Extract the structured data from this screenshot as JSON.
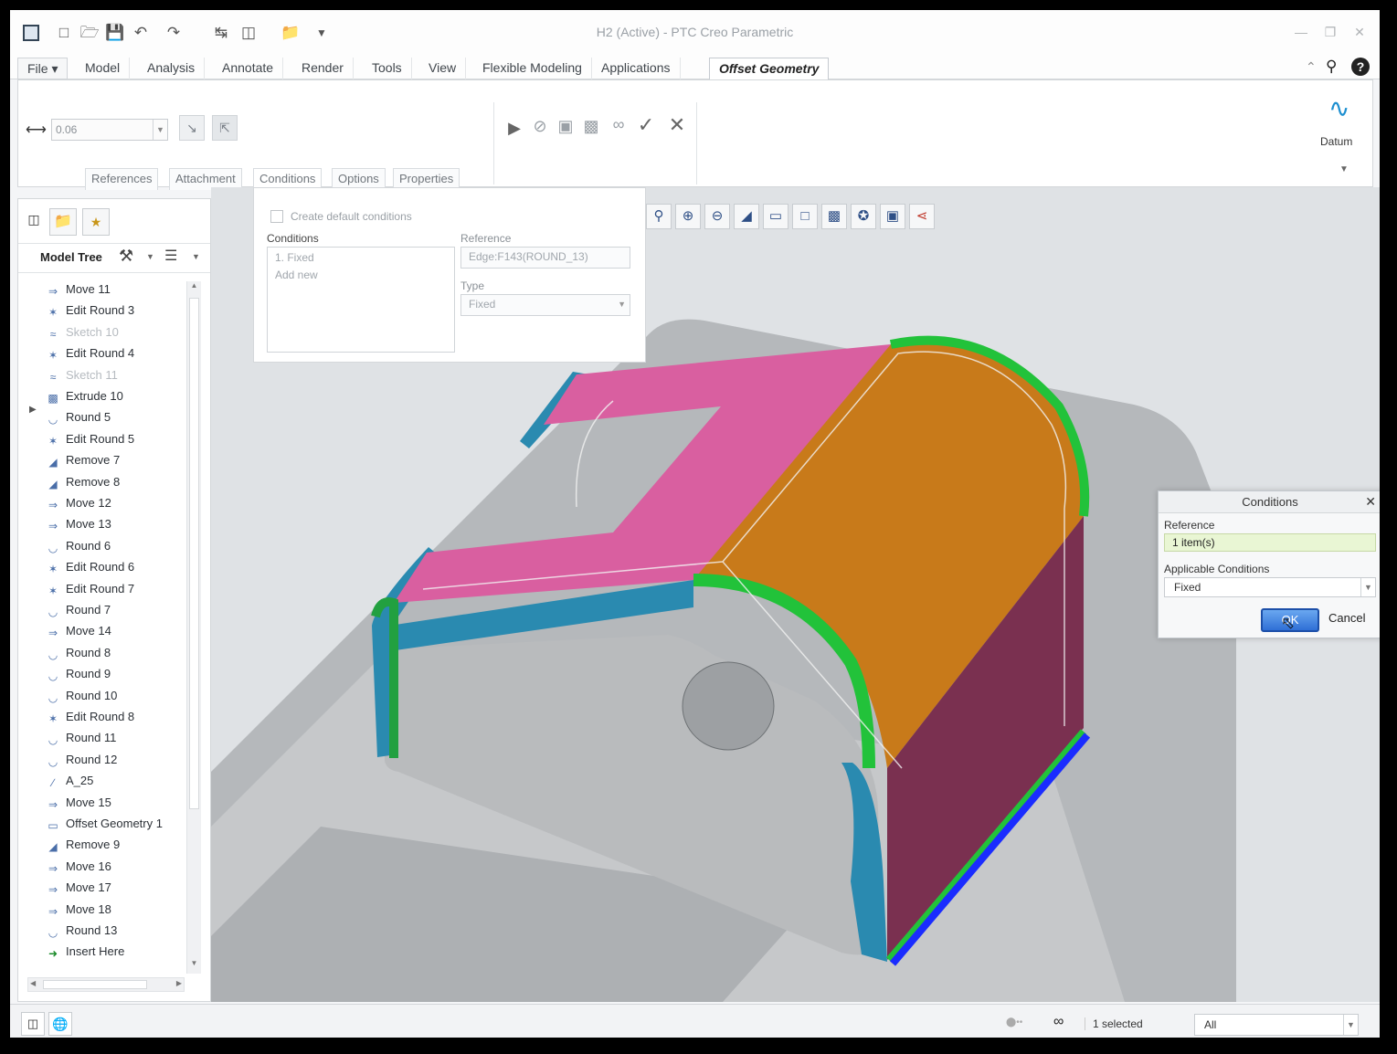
{
  "window": {
    "title": "H2 (Active) - PTC Creo Parametric"
  },
  "quick_access": [
    "app-icon",
    "new-icon",
    "open-icon",
    "save-icon",
    "undo-icon",
    "redo-icon",
    "regenerate-icon",
    "windows-icon",
    "close-window-icon",
    "customize-icon"
  ],
  "tabs": [
    {
      "label": "File",
      "x": 0
    },
    {
      "label": "Model"
    },
    {
      "label": "Analysis"
    },
    {
      "label": "Annotate"
    },
    {
      "label": "Render"
    },
    {
      "label": "Tools"
    },
    {
      "label": "View"
    },
    {
      "label": "Flexible Modeling"
    },
    {
      "label": "Applications"
    },
    {
      "label": "Offset Geometry"
    }
  ],
  "ribbon": {
    "offset_value": "0.06",
    "sub_tabs": [
      "References",
      "Attachment",
      "Conditions",
      "Options",
      "Properties"
    ],
    "datum_label": "Datum"
  },
  "conditions_panel": {
    "checkbox_label": "Create default conditions",
    "conditions_label": "Conditions",
    "conditions_items": [
      "1. Fixed",
      "Add new"
    ],
    "reference_label": "Reference",
    "reference_value": "Edge:F143(ROUND_13)",
    "type_label": "Type",
    "type_value": "Fixed"
  },
  "model_tree": {
    "title": "Model Tree",
    "items": [
      {
        "label": "Move 11",
        "icon": "move-icon",
        "dim": false
      },
      {
        "label": "Edit Round 3",
        "icon": "edit-round-icon",
        "dim": false
      },
      {
        "label": "Sketch 10",
        "icon": "sketch-icon",
        "dim": true
      },
      {
        "label": "Edit Round 4",
        "icon": "edit-round-icon",
        "dim": false
      },
      {
        "label": "Sketch 11",
        "icon": "sketch-icon",
        "dim": true
      },
      {
        "label": "Extrude 10",
        "icon": "extrude-icon",
        "dim": false
      },
      {
        "label": "Round 5",
        "icon": "round-icon",
        "dim": false
      },
      {
        "label": "Edit Round 5",
        "icon": "edit-round-icon",
        "dim": false
      },
      {
        "label": "Remove 7",
        "icon": "remove-icon",
        "dim": false
      },
      {
        "label": "Remove 8",
        "icon": "remove-icon",
        "dim": false
      },
      {
        "label": "Move 12",
        "icon": "move-icon",
        "dim": false
      },
      {
        "label": "Move 13",
        "icon": "move-icon",
        "dim": false
      },
      {
        "label": "Round 6",
        "icon": "round-icon",
        "dim": false
      },
      {
        "label": "Edit Round 6",
        "icon": "edit-round-icon",
        "dim": false
      },
      {
        "label": "Edit Round 7",
        "icon": "edit-round-icon",
        "dim": false
      },
      {
        "label": "Round 7",
        "icon": "round-icon",
        "dim": false
      },
      {
        "label": "Move 14",
        "icon": "move-icon",
        "dim": false
      },
      {
        "label": "Round 8",
        "icon": "round-icon",
        "dim": false
      },
      {
        "label": "Round 9",
        "icon": "round-icon",
        "dim": false
      },
      {
        "label": "Round 10",
        "icon": "round-icon",
        "dim": false
      },
      {
        "label": "Edit Round 8",
        "icon": "edit-round-icon",
        "dim": false
      },
      {
        "label": "Round 11",
        "icon": "round-icon",
        "dim": false
      },
      {
        "label": "Round 12",
        "icon": "round-icon",
        "dim": false
      },
      {
        "label": "A_25",
        "icon": "axis-icon",
        "dim": false
      },
      {
        "label": "Move 15",
        "icon": "move-icon",
        "dim": false
      },
      {
        "label": "Offset Geometry 1",
        "icon": "offset-icon",
        "dim": false
      },
      {
        "label": "Remove 9",
        "icon": "remove-icon",
        "dim": false
      },
      {
        "label": "Move 16",
        "icon": "move-icon",
        "dim": false
      },
      {
        "label": "Move 17",
        "icon": "move-icon",
        "dim": false
      },
      {
        "label": "Move 18",
        "icon": "move-icon",
        "dim": false
      },
      {
        "label": "Round 13",
        "icon": "round-icon",
        "dim": false
      },
      {
        "label": "Insert Here",
        "icon": "insert-here-icon",
        "dim": false
      }
    ]
  },
  "dialog": {
    "title": "Conditions",
    "reference_label": "Reference",
    "reference_value": "1 item(s)",
    "applicable_label": "Applicable Conditions",
    "applicable_value": "Fixed",
    "ok_label": "OK",
    "cancel_label": "Cancel"
  },
  "status": {
    "selected_text": "1 selected",
    "filter_value": "All"
  },
  "colors": {
    "accent": "#2f6fd6",
    "face_pink": "#d95fa0",
    "face_orange": "#c87a1a",
    "face_teal": "#2a8ab0",
    "face_green": "#22c23a",
    "edge_blue": "#1a2cff"
  }
}
